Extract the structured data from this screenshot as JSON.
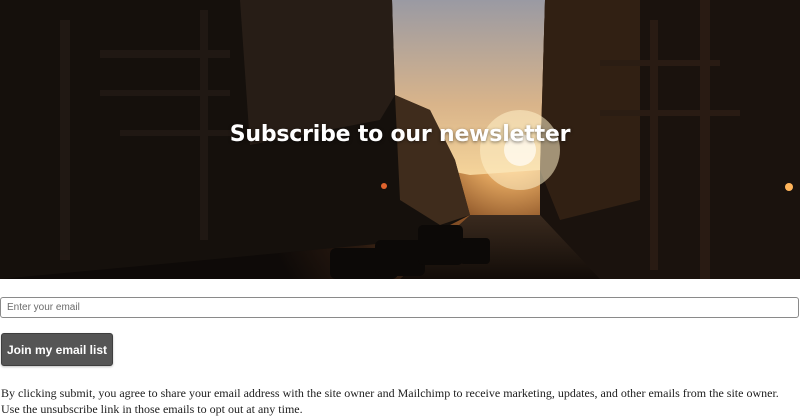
{
  "hero": {
    "title": "Subscribe to our newsletter",
    "image": "city-street-sunset-photo"
  },
  "form": {
    "email_placeholder": "Enter your email",
    "email_value": "",
    "submit_label": "Join my email list"
  },
  "disclaimer": "By clicking submit, you agree to share your email address with the site owner and Mailchimp to receive marketing, updates, and other emails from the site owner. Use the unsubscribe link in those emails to opt out at any time.",
  "colors": {
    "button_bg": "#555555",
    "button_text": "#ffffff",
    "title_text": "#ffffff"
  }
}
